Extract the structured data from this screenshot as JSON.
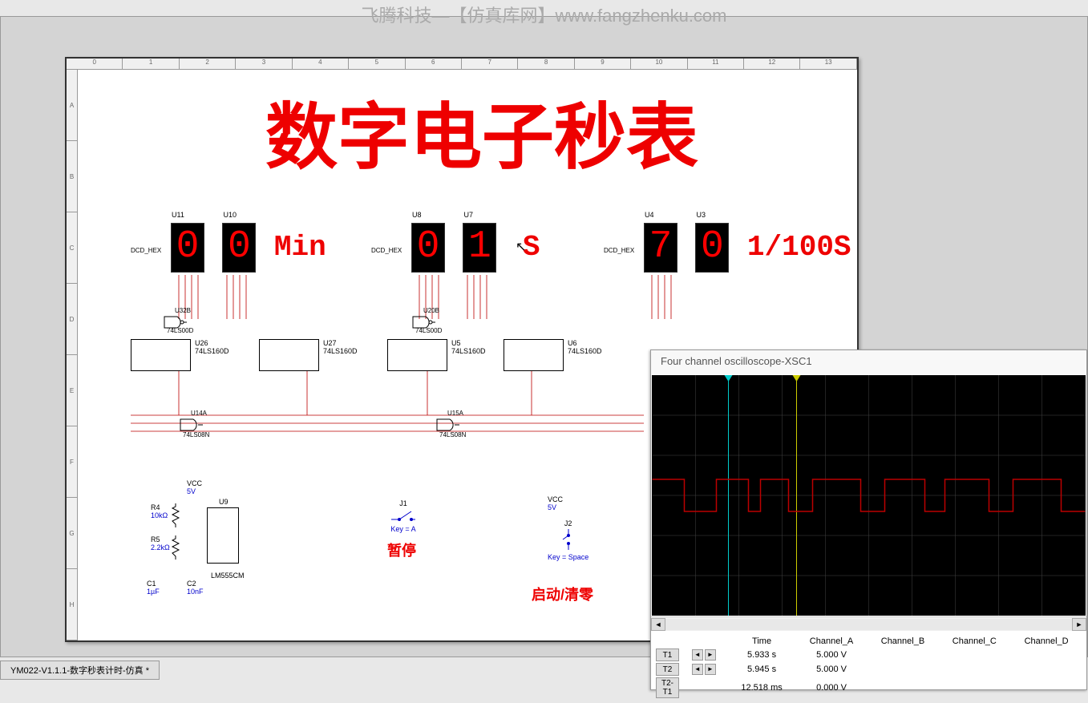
{
  "watermark": "飞腾科技—【仿真库网】www.fangzhenku.com",
  "bottom_tab": "YM022-V1.1.1-数字秒表计时-仿真 *",
  "schematic": {
    "title": "数字电子秒表",
    "ruler_top": [
      "0",
      "1",
      "2",
      "3",
      "4",
      "5",
      "6",
      "7",
      "8",
      "9",
      "10",
      "11",
      "12",
      "13"
    ],
    "ruler_left": [
      "A",
      "B",
      "C",
      "D",
      "E",
      "F",
      "G",
      "H"
    ],
    "displays": {
      "min": {
        "u1": "U11",
        "d1": "0",
        "u2": "U10",
        "d2": "0",
        "label": "Min",
        "dcd": "DCD_HEX"
      },
      "sec": {
        "u1": "U8",
        "d1": "0",
        "u2": "U7",
        "d2": "1",
        "label": "S",
        "dcd": "DCD_HEX"
      },
      "hsec": {
        "u1": "U4",
        "d1": "7",
        "u2": "U3",
        "d2": "0",
        "label": "1/100S",
        "dcd": "DCD_HEX"
      }
    },
    "ics": {
      "u26": {
        "ref": "U26",
        "part": "74LS160D"
      },
      "u27": {
        "ref": "U27",
        "part": "74LS160D"
      },
      "u5": {
        "ref": "U5",
        "part": "74LS160D"
      },
      "u6": {
        "ref": "U6",
        "part": "74LS160D"
      },
      "u32b": {
        "ref": "U32B",
        "part": "74LS00D"
      },
      "u20b": {
        "ref": "U20B",
        "part": "74LS00D"
      },
      "u14a": {
        "ref": "U14A",
        "part": "74LS08N"
      },
      "u15a": {
        "ref": "U15A",
        "part": "74LS08N"
      },
      "u9": {
        "ref": "U9",
        "part": "LM555CM"
      }
    },
    "components": {
      "vcc": "VCC",
      "v5": "5V",
      "r4": {
        "ref": "R4",
        "val": "10kΩ"
      },
      "r5": {
        "ref": "R5",
        "val": "2.2kΩ"
      },
      "c1": {
        "ref": "C1",
        "val": "1µF"
      },
      "c2": {
        "ref": "C2",
        "val": "10nF"
      },
      "j1": {
        "ref": "J1",
        "key": "Key = A"
      },
      "j2": {
        "ref": "J2",
        "key": "Key = Space"
      }
    },
    "labels": {
      "pause": "暂停",
      "start": "启动/清零"
    }
  },
  "oscilloscope": {
    "title": "Four channel oscilloscope-XSC1",
    "table": {
      "headers": [
        "",
        "",
        "Time",
        "Channel_A",
        "Channel_B",
        "Channel_C",
        "Channel_D"
      ],
      "t1": {
        "label": "T1",
        "time": "5.933 s",
        "a": "5.000 V"
      },
      "t2": {
        "label": "T2",
        "time": "5.945 s",
        "a": "5.000 V"
      },
      "diff": {
        "label": "T2-T1",
        "time": "12.518 ms",
        "a": "0.000 V"
      }
    }
  }
}
